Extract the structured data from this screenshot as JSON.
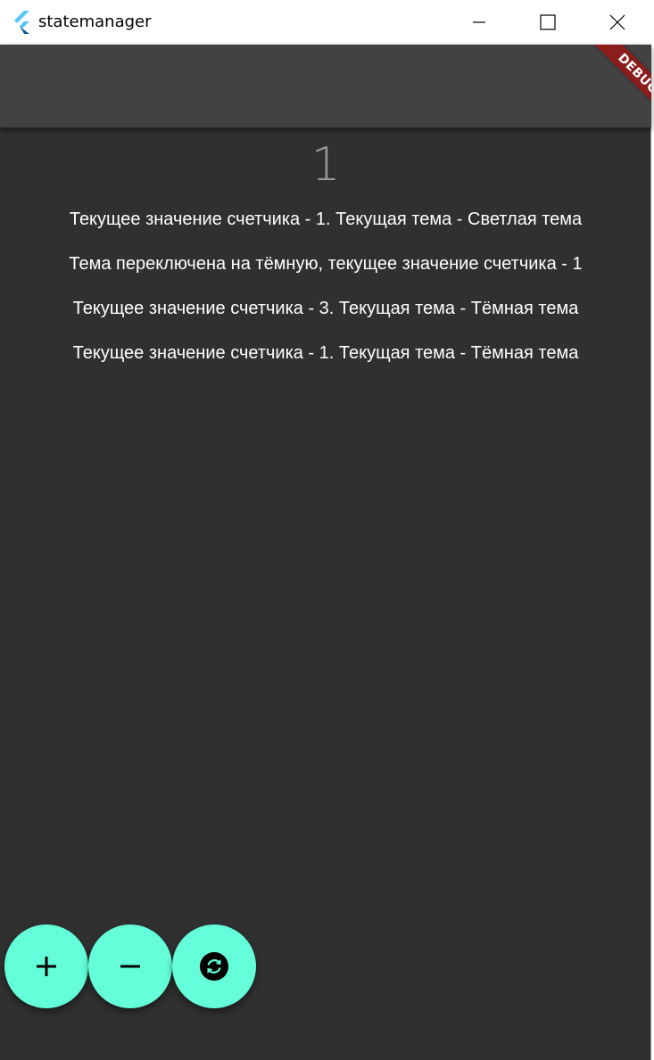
{
  "window": {
    "title": "statemanager",
    "controls": [
      "minimize-icon",
      "maximize-icon",
      "close-icon"
    ]
  },
  "appbar": {
    "debug_banner": "DEBUG",
    "banner_color": "#8b1d1d"
  },
  "main": {
    "counter_value": "1",
    "messages": [
      "Текущее значение счетчика - 1. Текущая тема - Светлая тема",
      "Тема переключена на тёмную, текущее значение счетчика - 1",
      "Текущее значение счетчика - 3. Текущая тема - Тёмная тема",
      "Текущее значение счетчика - 1. Текущая тема - Тёмная тема"
    ]
  },
  "fabs": [
    {
      "icon": "add-icon"
    },
    {
      "icon": "remove-icon"
    },
    {
      "icon": "sync-icon"
    }
  ],
  "colors": {
    "background": "#303030",
    "appbar": "#424242",
    "accent": "#64ffda",
    "counter_text": "#9a9a9a"
  }
}
